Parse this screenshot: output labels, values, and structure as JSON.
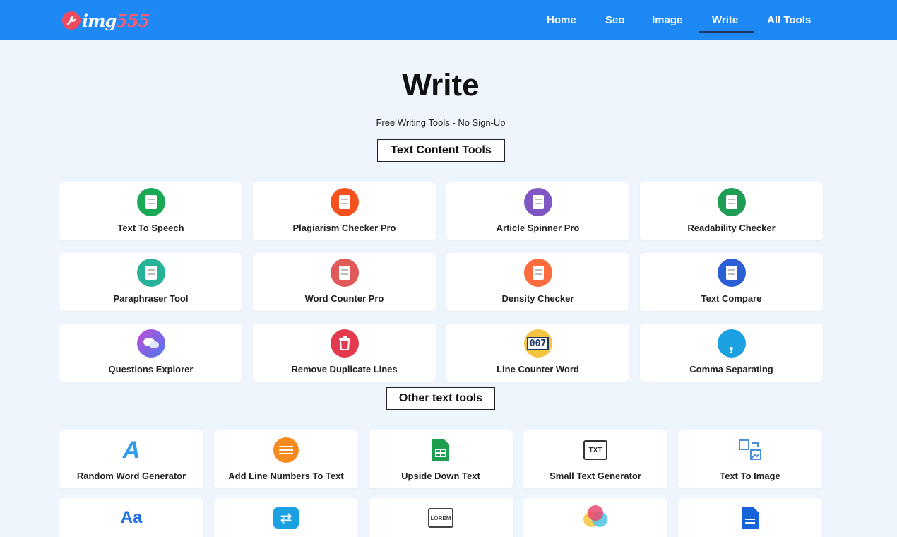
{
  "brand": {
    "badge": "🔧",
    "name": "img",
    "number": "555"
  },
  "nav": {
    "home": "Home",
    "seo": "Seo",
    "image": "Image",
    "write": "Write",
    "all_tools": "All Tools"
  },
  "page": {
    "title": "Write",
    "subtitle": "Free Writing Tools - No Sign-Up"
  },
  "sections": {
    "text_content": "Text Content Tools",
    "other_text": "Other text tools"
  },
  "text_content_tools": [
    {
      "label": "Text To Speech",
      "icon": "speech-doc-icon",
      "color": "#1aaa55"
    },
    {
      "label": "Plagiarism Checker Pro",
      "icon": "checklist-icon",
      "color": "#f4511e"
    },
    {
      "label": "Article Spinner Pro",
      "icon": "browser-window-icon",
      "color": "#7e57c2"
    },
    {
      "label": "Readability Checker",
      "icon": "document-icon",
      "color": "#1f9d55"
    },
    {
      "label": "Paraphraser Tool",
      "icon": "edit-doc-icon",
      "color": "#26b39a"
    },
    {
      "label": "Word Counter Pro",
      "icon": "edit-doc-icon",
      "color": "#e05a5a"
    },
    {
      "label": "Density Checker",
      "icon": "notepad-icon",
      "color": "#ff6b3d"
    },
    {
      "label": "Text Compare",
      "icon": "compare-doc-icon",
      "color": "#2c5fd4"
    },
    {
      "label": "Questions Explorer",
      "icon": "chat-bubbles-icon",
      "color": "#8e44ad"
    },
    {
      "label": "Remove Duplicate Lines",
      "icon": "trash-icon",
      "color": "#e53950"
    },
    {
      "label": "Line Counter Word",
      "icon": "counter-icon",
      "color": "#f5c542",
      "counter": "007"
    },
    {
      "label": "Comma Separating",
      "icon": "comma-icon",
      "color": "#1ba1e2",
      "glyph": ","
    }
  ],
  "other_text_tools": [
    {
      "label": "Random Word Generator",
      "icon": "letter-a-icon",
      "color": "#2d9cf0",
      "glyph": "A"
    },
    {
      "label": "Add Line Numbers To Text",
      "icon": "list-icon",
      "color": "#f58a1f"
    },
    {
      "label": "Upside Down Text",
      "icon": "sheet-icon",
      "color": "#1e9e4f"
    },
    {
      "label": "Small Text Generator",
      "icon": "txt-file-icon",
      "color": "#333333",
      "glyph": "TXT"
    },
    {
      "label": "Text To Image",
      "icon": "text-to-image-icon",
      "color": "#4a90d9"
    },
    {
      "label": "",
      "icon": "font-aa-icon",
      "color": "#1e6ee8",
      "glyph": "Aa"
    },
    {
      "label": "",
      "icon": "swap-arrows-icon",
      "color": "#1ba1e2",
      "glyph": "⇄"
    },
    {
      "label": "",
      "icon": "lorem-icon",
      "color": "#444444",
      "glyph": "LOREM"
    },
    {
      "label": "",
      "icon": "color-circles-icon",
      "color": "#e84a6f"
    },
    {
      "label": "",
      "icon": "blue-document-icon",
      "color": "#1565d8"
    }
  ]
}
